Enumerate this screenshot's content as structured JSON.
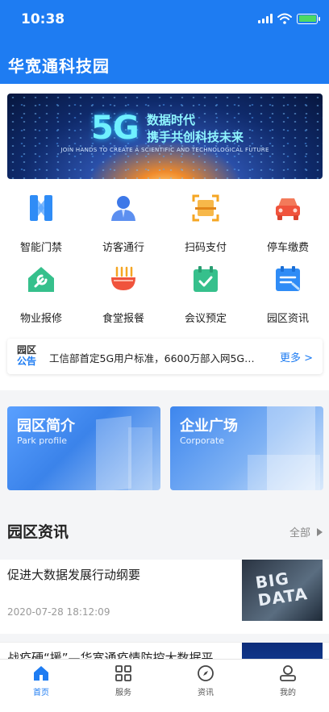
{
  "status_bar": {
    "time": "10:38"
  },
  "app": {
    "title": "华宽通科技园"
  },
  "banner": {
    "big": "5G",
    "line1": "数据时代",
    "line2": "携手共创科技未来",
    "english": "JOIN HANDS TO CREATE A SCIENTIFIC AND TECHNOLOGICAL FUTURE"
  },
  "grid": [
    {
      "label": "智能门禁",
      "icon": "smart-gate-icon"
    },
    {
      "label": "访客通行",
      "icon": "visitor-icon"
    },
    {
      "label": "扫码支付",
      "icon": "scan-pay-icon"
    },
    {
      "label": "停车缴费",
      "icon": "parking-icon"
    },
    {
      "label": "物业报修",
      "icon": "repair-icon"
    },
    {
      "label": "食堂报餐",
      "icon": "canteen-icon"
    },
    {
      "label": "会议预定",
      "icon": "meeting-icon"
    },
    {
      "label": "园区资讯",
      "icon": "park-news-icon"
    }
  ],
  "notice": {
    "logo_line1": "园区",
    "logo_line2": "公告",
    "text": "工信部首定5G用户标准，6600万部入网5G…",
    "more": "更多 >"
  },
  "promos": [
    {
      "title": "园区简介",
      "subtitle": "Park profile"
    },
    {
      "title": "企业广场",
      "subtitle": "Corporate"
    }
  ],
  "news": {
    "heading": "园区资讯",
    "all_label": "全部",
    "items": [
      {
        "title": "促进大数据发展行动纲要",
        "date": "2020-07-28 18:12:09",
        "thumb_text": "BIG DATA"
      },
      {
        "title": "战疫硬“援”—华宽通疫情防控大数据平",
        "date": "",
        "thumb_text": ""
      }
    ]
  },
  "tabbar": [
    {
      "label": "首页",
      "icon": "home-icon",
      "active": true
    },
    {
      "label": "服务",
      "icon": "grid-icon",
      "active": false
    },
    {
      "label": "资讯",
      "icon": "compass-icon",
      "active": false
    },
    {
      "label": "我的",
      "icon": "user-icon",
      "active": false
    }
  ],
  "colors": {
    "primary": "#1e7cf2",
    "orange": "#f5a623",
    "red": "#f0533c"
  }
}
